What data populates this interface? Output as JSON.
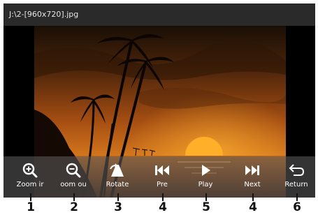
{
  "window": {
    "title": "J:\\2-[960x720].jpg"
  },
  "toolbar": {
    "buttons": [
      {
        "label": "Zoom ir",
        "icon": "zoom-in-icon"
      },
      {
        "label": "oom ou",
        "icon": "zoom-out-icon"
      },
      {
        "label": "Rotate",
        "icon": "rotate-icon"
      },
      {
        "label": "Pre",
        "icon": "previous-icon"
      },
      {
        "label": "Play",
        "icon": "play-icon"
      },
      {
        "label": "Next",
        "icon": "next-icon"
      },
      {
        "label": "Return",
        "icon": "return-icon"
      }
    ]
  },
  "callouts": [
    "1",
    "2",
    "3",
    "4",
    "5",
    "4",
    "6"
  ],
  "colors": {
    "toolbar_text": "#ffffff",
    "titlebar": "#2a2a2a",
    "sky": "#b4530f",
    "sun": "#ffb028"
  }
}
